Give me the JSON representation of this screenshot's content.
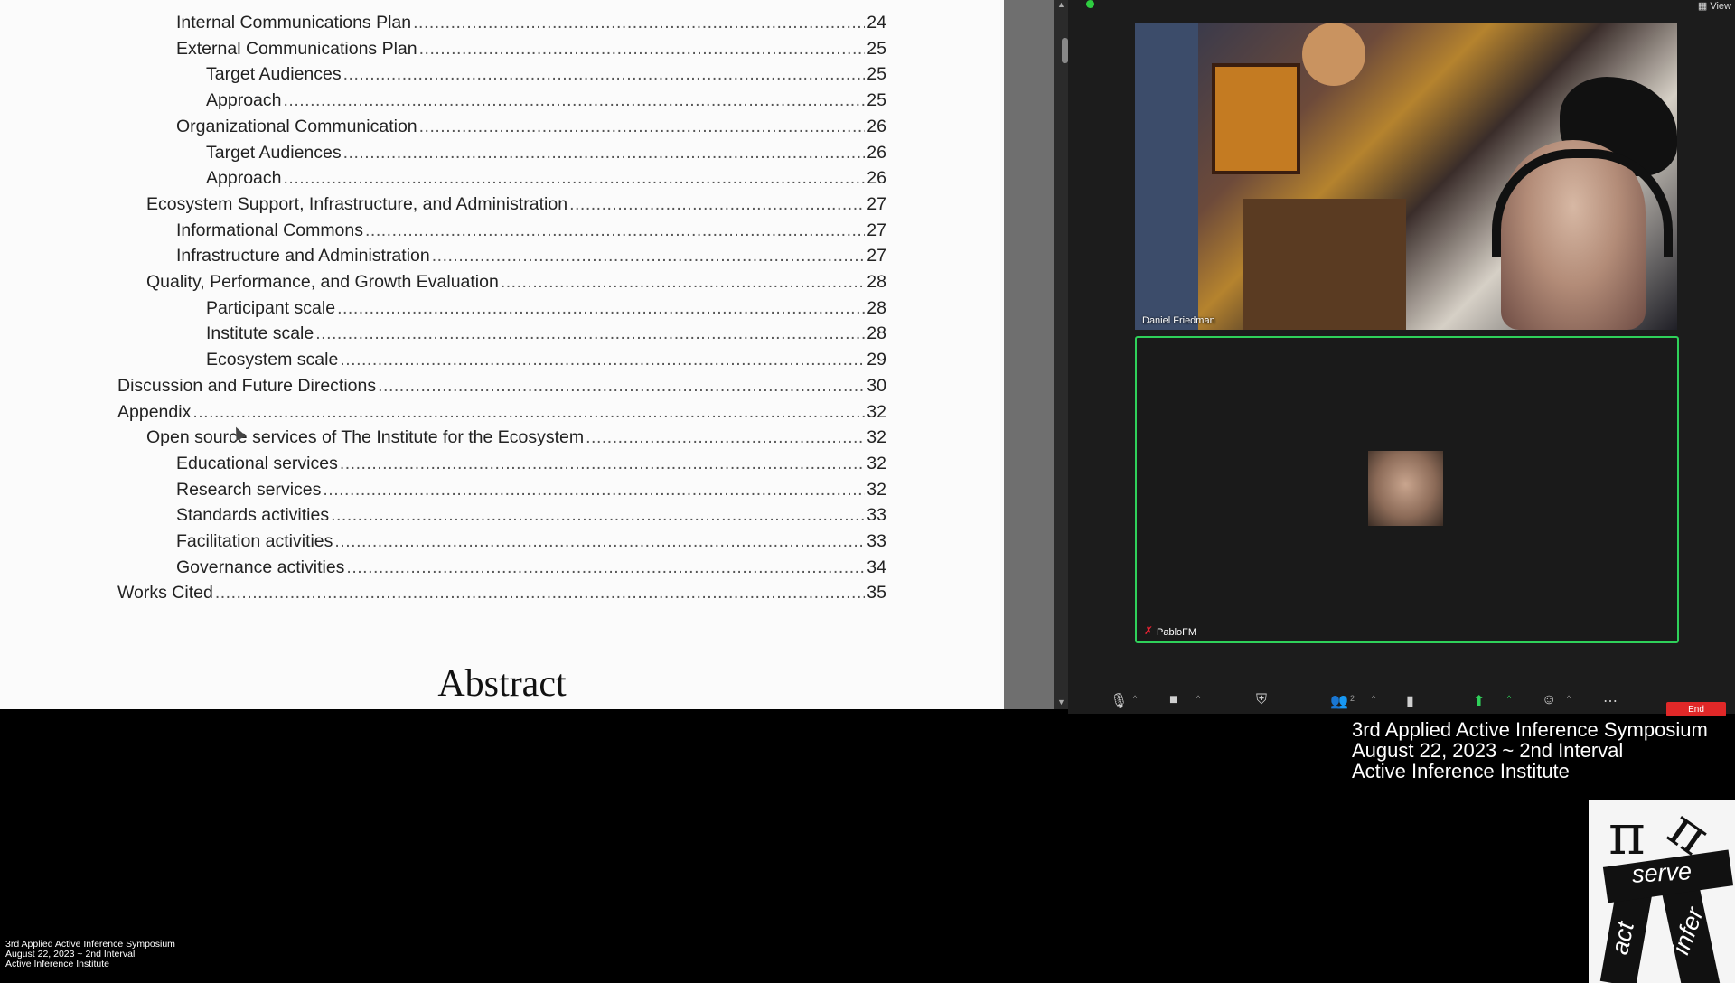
{
  "toc": [
    {
      "title": "Internal Communications Plan",
      "page": "24",
      "level": 2
    },
    {
      "title": "External Communications Plan",
      "page": "25",
      "level": 2
    },
    {
      "title": "Target Audiences",
      "page": "25",
      "level": 3
    },
    {
      "title": "Approach",
      "page": "25",
      "level": 3
    },
    {
      "title": "Organizational Communication",
      "page": "26",
      "level": 2
    },
    {
      "title": "Target Audiences",
      "page": "26",
      "level": 3
    },
    {
      "title": "Approach",
      "page": "26",
      "level": 3
    },
    {
      "title": "Ecosystem Support, Infrastructure, and Administration",
      "page": "27",
      "level": 1
    },
    {
      "title": "Informational Commons",
      "page": "27",
      "level": 2
    },
    {
      "title": "Infrastructure and Administration",
      "page": "27",
      "level": 2
    },
    {
      "title": "Quality, Performance, and Growth Evaluation",
      "page": "28",
      "level": 1
    },
    {
      "title": "Participant scale",
      "page": "28",
      "level": 3
    },
    {
      "title": "Institute scale",
      "page": "28",
      "level": 3
    },
    {
      "title": "Ecosystem scale",
      "page": "29",
      "level": 3
    },
    {
      "title": "Discussion and Future Directions",
      "page": "30",
      "level": 0
    },
    {
      "title": "Appendix",
      "page": "32",
      "level": 0
    },
    {
      "title": "Open source services of The Institute for the Ecosystem",
      "page": "32",
      "level": 1
    },
    {
      "title": "Educational services",
      "page": "32",
      "level": 2
    },
    {
      "title": "Research services",
      "page": "32",
      "level": 2
    },
    {
      "title": "Standards activities",
      "page": "33",
      "level": 2
    },
    {
      "title": "Facilitation activities",
      "page": "33",
      "level": 2
    },
    {
      "title": "Governance activities",
      "page": "34",
      "level": 2
    },
    {
      "title": "Works Cited",
      "page": "35",
      "level": 0
    }
  ],
  "abstract_heading": "Abstract",
  "call": {
    "view_label": "View",
    "participants": [
      {
        "name": "Daniel Friedman"
      },
      {
        "name": "PabloFM"
      }
    ],
    "controls": {
      "participants_count": "2",
      "end_label": "End"
    },
    "colors": {
      "active_speaker": "#2fd15a",
      "end": "#e02828"
    }
  },
  "caption": {
    "line1": "3rd Applied Active Inference Symposium",
    "line2": "August 22, 2023 ~ 2nd Interval",
    "line3": "Active Inference Institute"
  },
  "logo": {
    "word_top": "serve",
    "word_left": "act",
    "word_right": "infer"
  },
  "small_caption": {
    "line1": "3rd Applied Active Inference Symposium",
    "line2": "August 22, 2023 ~ 2nd Interval",
    "line3": "Active Inference Institute"
  }
}
